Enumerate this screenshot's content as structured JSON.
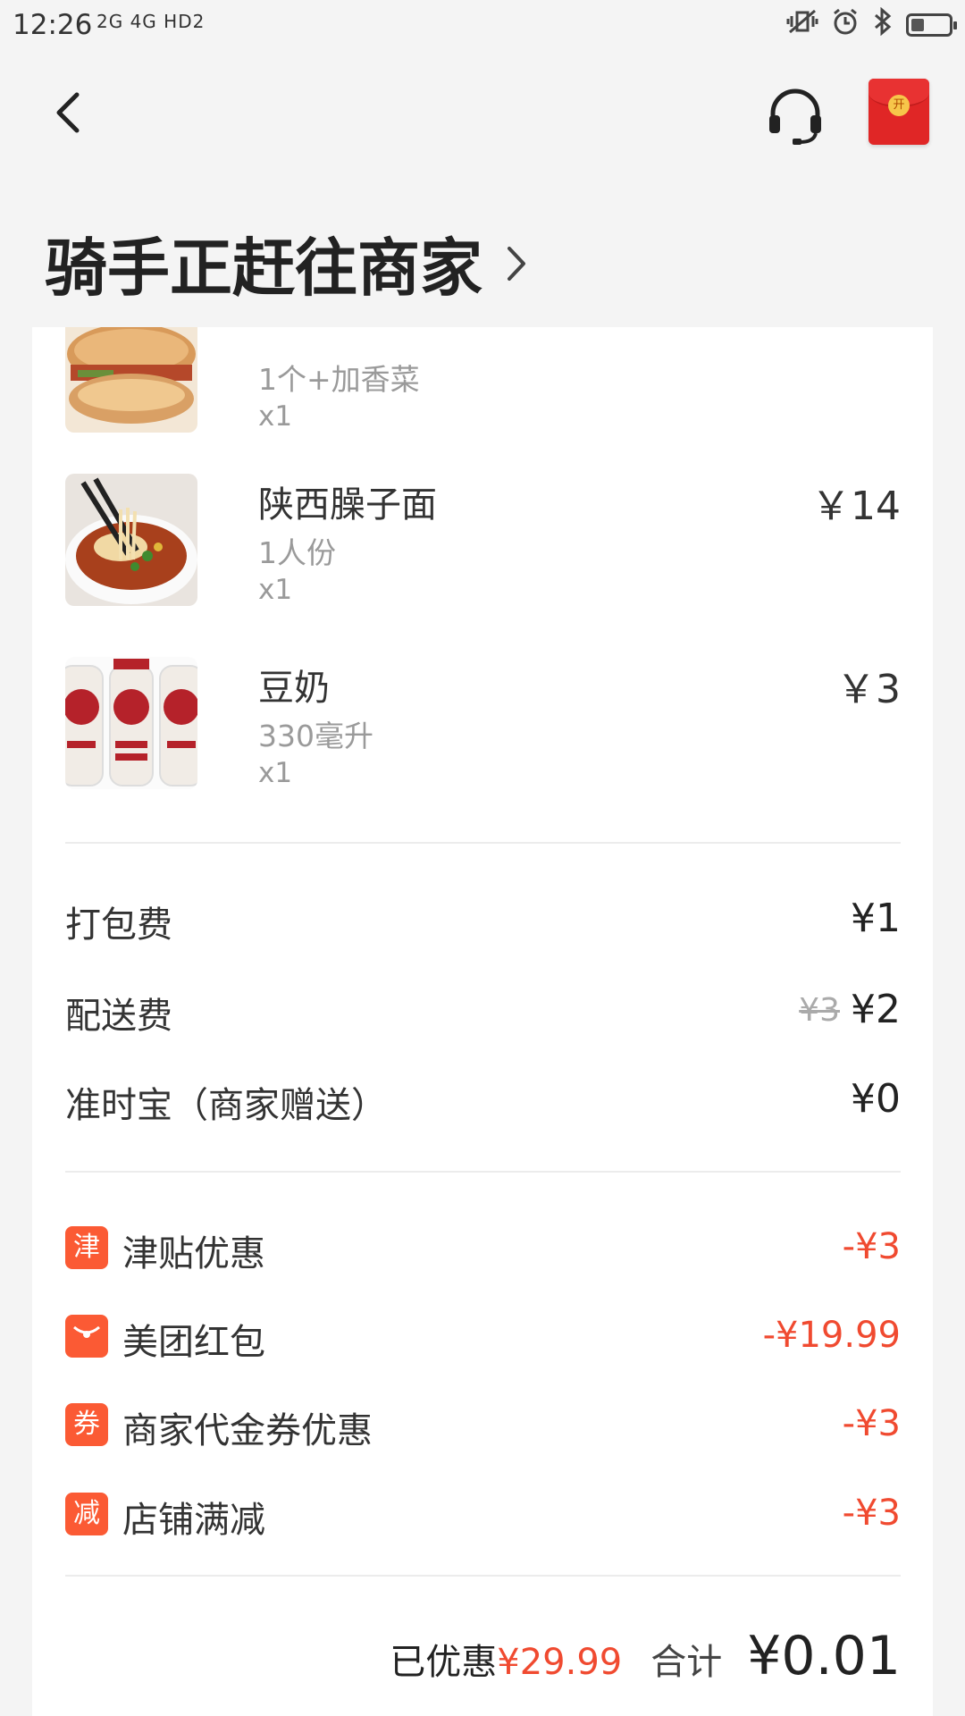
{
  "status_bar": {
    "time": "12:26",
    "network": "2G 4G HD2",
    "battery_level": 0.35
  },
  "header": {
    "title": "骑手正赶往商家"
  },
  "items": [
    {
      "name": "",
      "spec": "1个+加香菜",
      "qty": "x1",
      "price": ""
    },
    {
      "name": "陕西臊子面",
      "spec": "1人份",
      "qty": "x1",
      "price": "￥14"
    },
    {
      "name": "豆奶",
      "spec": "330毫升",
      "qty": "x1",
      "price": "￥3"
    }
  ],
  "fees": [
    {
      "label": "打包费",
      "value": "¥1",
      "original": ""
    },
    {
      "label": "配送费",
      "value": "¥2",
      "original": "¥3"
    },
    {
      "label": "准时宝（商家赠送）",
      "value": "¥0",
      "original": ""
    }
  ],
  "discounts": [
    {
      "badge": "津",
      "label": "津贴优惠",
      "value": "-¥3"
    },
    {
      "badge": "",
      "label": "美团红包",
      "value": "-¥19.99"
    },
    {
      "badge": "券",
      "label": "商家代金券优惠",
      "value": "-¥3"
    },
    {
      "badge": "减",
      "label": "店铺满减",
      "value": "-¥3"
    }
  ],
  "summary": {
    "saved_label": "已优惠",
    "saved_amount": "¥29.99",
    "total_label": "合计",
    "total_amount": "¥0.01"
  },
  "colors": {
    "accent": "#f04a30",
    "badge": "#fb5a34",
    "red_packet": "#e02626"
  }
}
